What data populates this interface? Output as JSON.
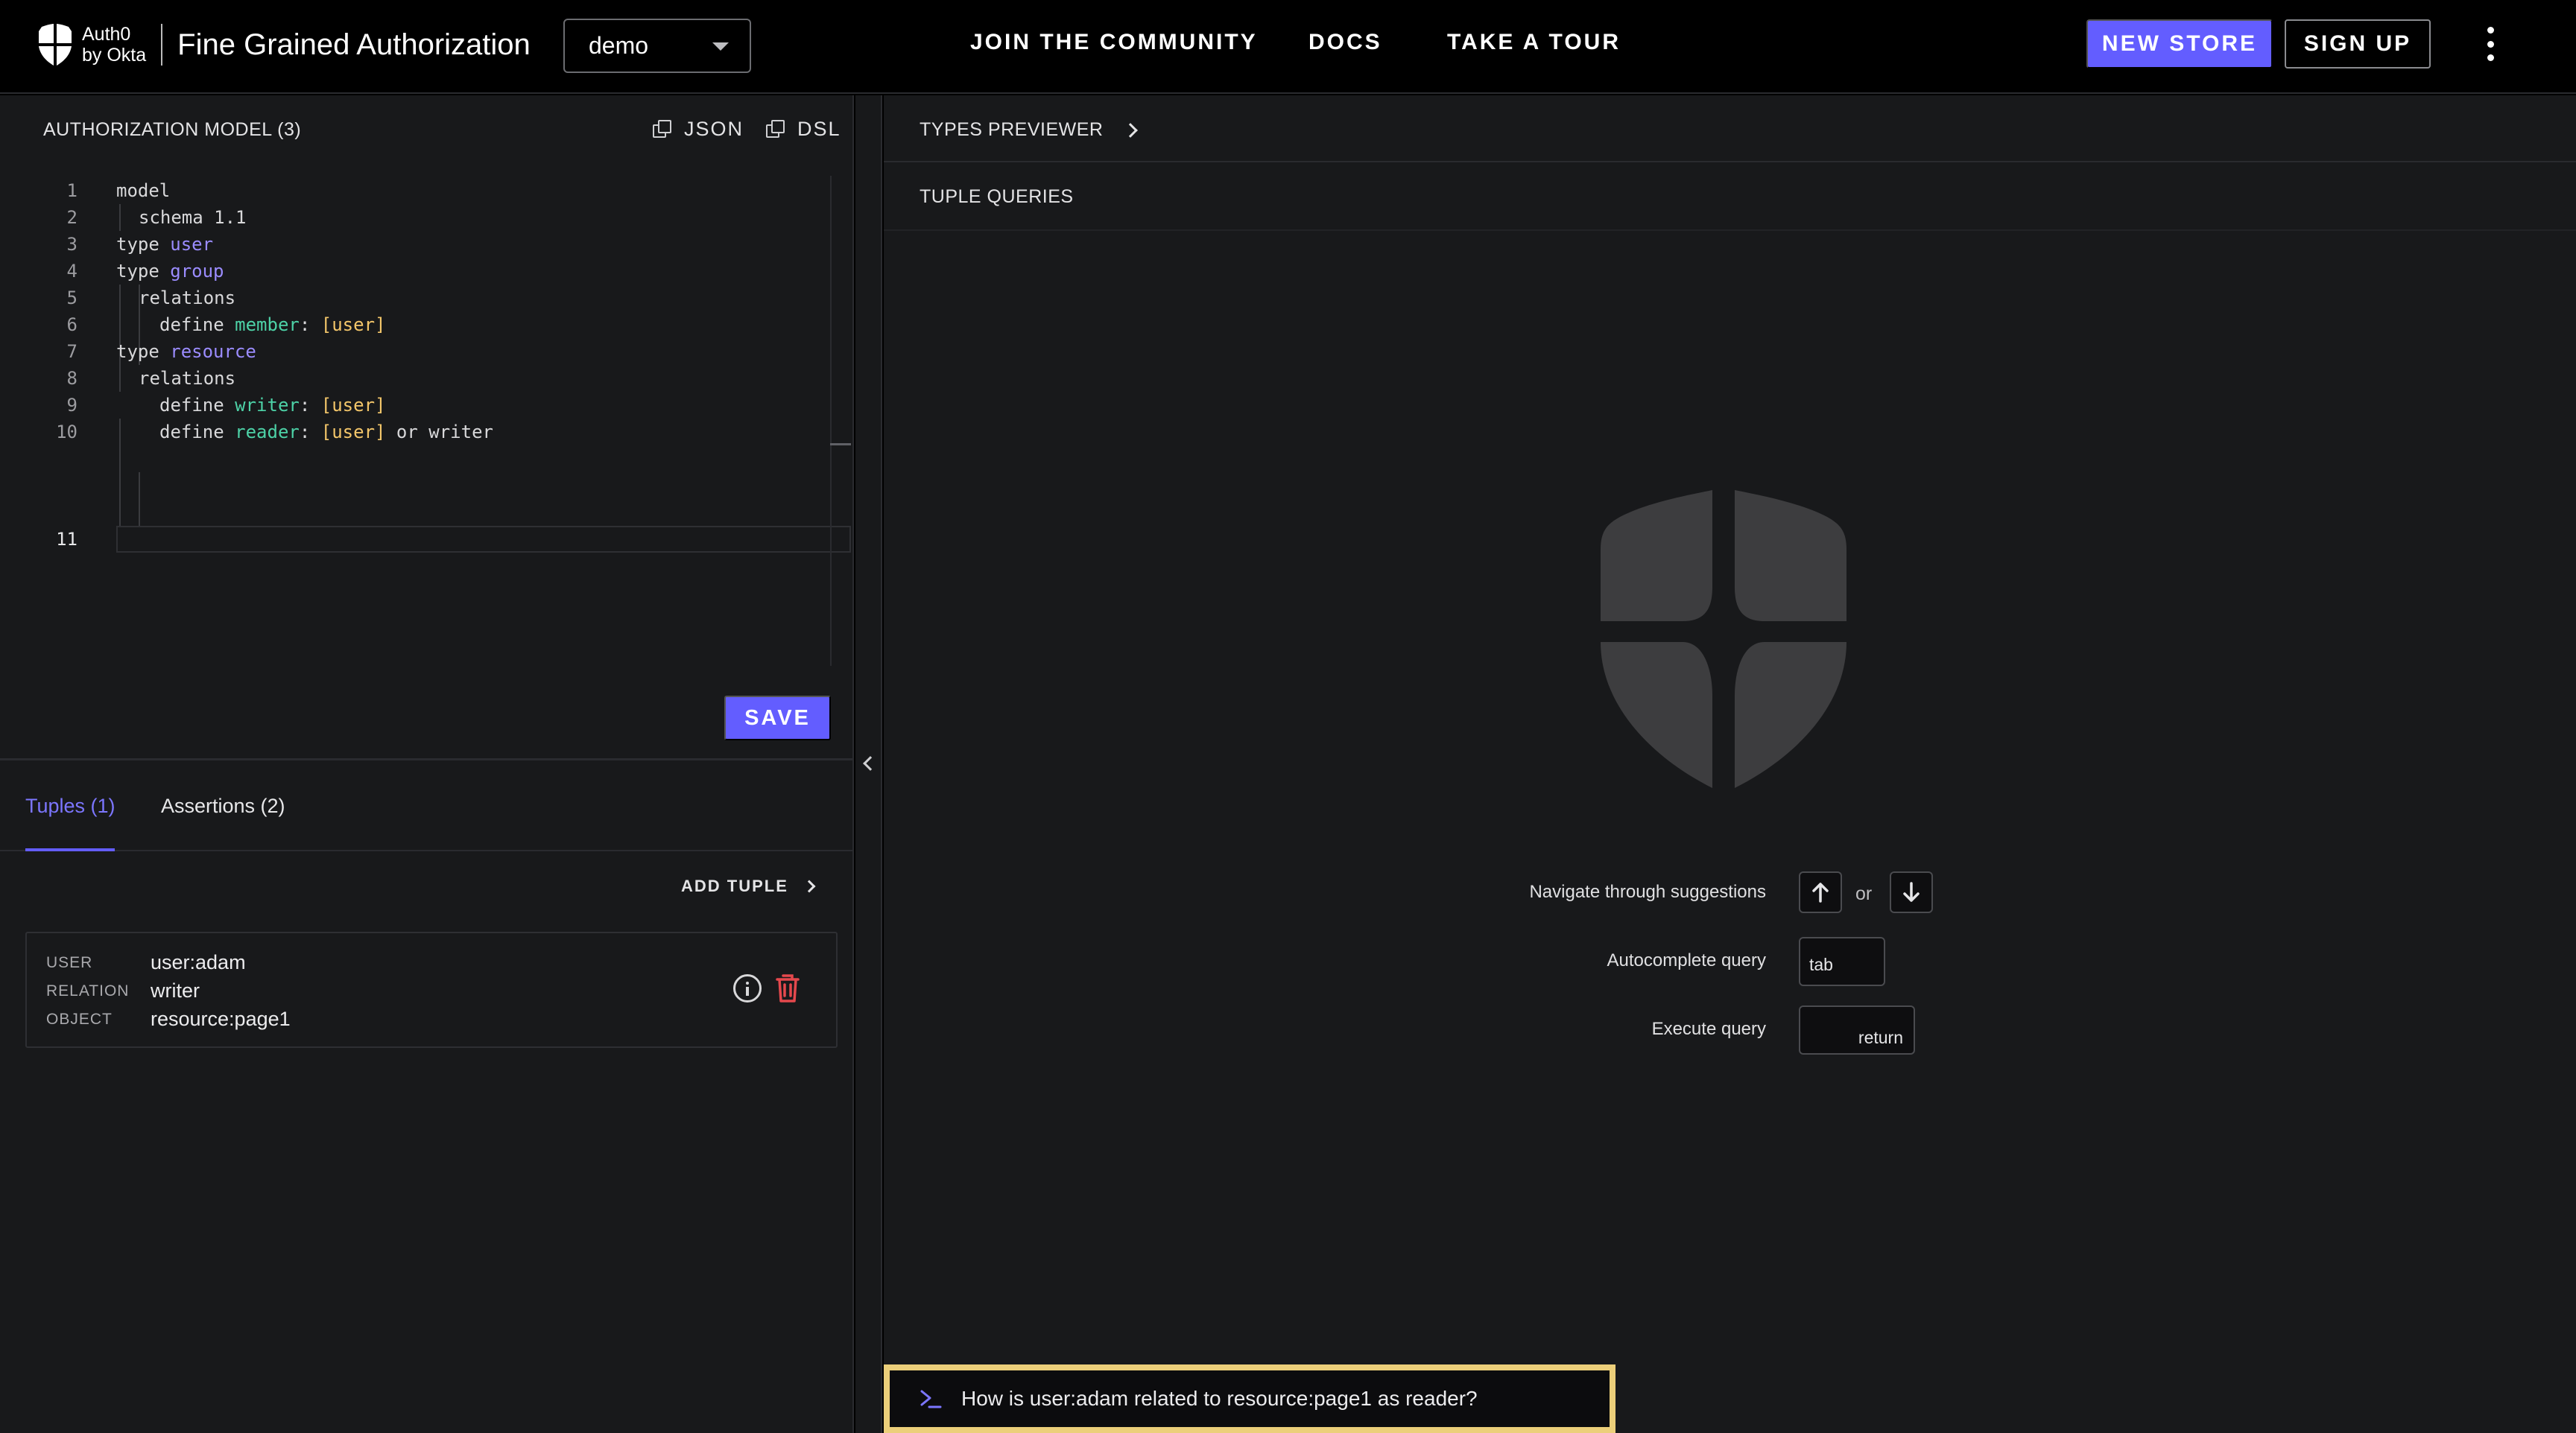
{
  "header": {
    "logo_line1": "Auth0",
    "logo_line2": "by Okta",
    "product_name": "Fine Grained Authorization",
    "store_selected": "demo",
    "nav": {
      "community": "JOIN  THE COMMUNITY",
      "docs": "DOCS",
      "tour": "TAKE A  TOUR"
    },
    "new_store_label": "NEW STORE",
    "sign_up_label": "SIGN UP"
  },
  "model": {
    "title": "AUTHORIZATION MODEL (3)",
    "json_label": "JSON",
    "dsl_label": "DSL",
    "line_numbers": [
      "1",
      "2",
      "3",
      "4",
      "5",
      "6",
      "7",
      "8",
      "9",
      "10",
      "11"
    ],
    "lines": {
      "l1": "model",
      "l2a": "schema ",
      "l2b": "1.1",
      "l3a": "type ",
      "l3b": "user",
      "l4a": "type ",
      "l4b": "group",
      "l5": "relations",
      "l6a": "define ",
      "l6b": "member",
      "l6c": ": ",
      "l6d": "[user]",
      "l7a": "type ",
      "l7b": "resource",
      "l8": "relations",
      "l9a": "define ",
      "l9b": "writer",
      "l9c": ": ",
      "l9d": "[user]",
      "l10a": "define ",
      "l10b": "reader",
      "l10c": ": ",
      "l10d": "[user]",
      "l10e": " or writer"
    },
    "save_label": "SAVE"
  },
  "tabs": {
    "tuples": "Tuples (1)",
    "assertions": "Assertions (2)"
  },
  "add_tuple_label": "ADD TUPLE",
  "tuple": {
    "user_label": "USER",
    "user_value": "user:adam",
    "relation_label": "RELATION",
    "relation_value": "writer",
    "object_label": "OBJECT",
    "object_value": "resource:page1"
  },
  "right": {
    "types_previewer": "TYPES PREVIEWER",
    "tuple_queries": "TUPLE QUERIES",
    "hints": {
      "navigate": "Navigate through suggestions",
      "or": "or",
      "autocomplete": "Autocomplete query",
      "tab_key": "tab",
      "execute": "Execute query",
      "return_key": "return"
    },
    "query_value": "How is user:adam related to resource:page1 as reader?"
  },
  "colors": {
    "accent": "#635dff",
    "highlight_border": "#eccf7a",
    "type_name": "#9b8cff",
    "relation_name": "#4dd2a7",
    "user_type": "#f3c66a",
    "delete": "#e5484d"
  }
}
